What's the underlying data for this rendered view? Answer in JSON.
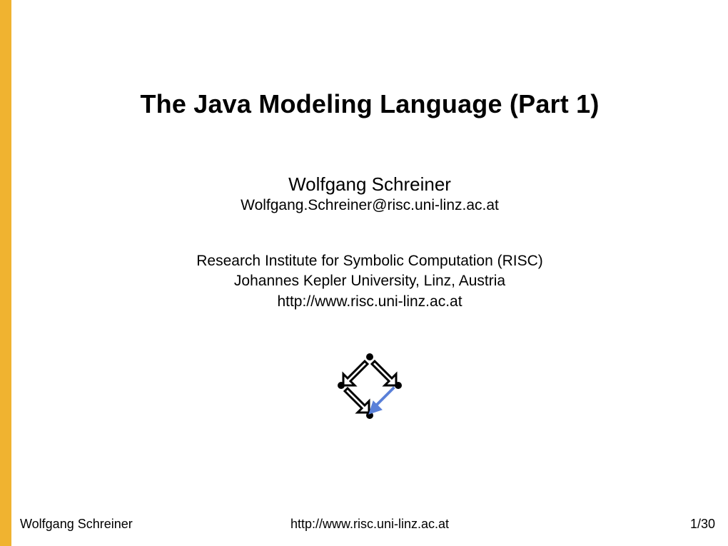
{
  "title": "The Java Modeling Language (Part 1)",
  "author": {
    "name": "Wolfgang Schreiner",
    "email": "Wolfgang.Schreiner@risc.uni-linz.ac.at"
  },
  "affiliation": {
    "line1": "Research Institute for Symbolic Computation (RISC)",
    "line2": "Johannes Kepler University, Linz, Austria",
    "url": "http://www.risc.uni-linz.ac.at"
  },
  "footer": {
    "author": "Wolfgang Schreiner",
    "url": "http://www.risc.uni-linz.ac.at",
    "page": "1/30"
  },
  "colors": {
    "accent": "#f0b330",
    "logo_arrow": "#5a80d8"
  }
}
